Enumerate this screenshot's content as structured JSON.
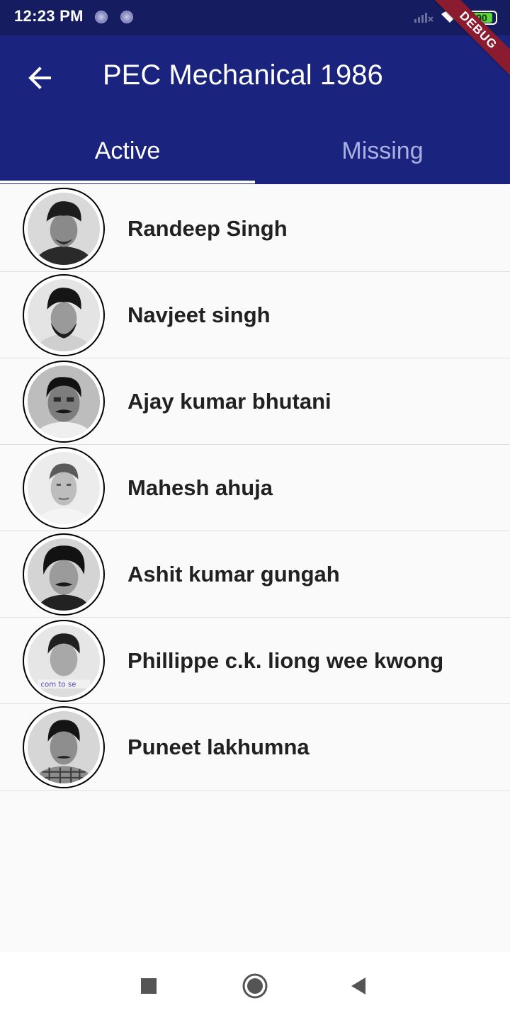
{
  "status_bar": {
    "time": "12:23 PM",
    "notification_icons": [
      "app-notification-icon",
      "app-notification-icon"
    ],
    "signal_icon": "signal-off-icon",
    "wifi_icon": "wifi-icon",
    "battery_level": "90",
    "battery_color": "#5fd33a"
  },
  "debug_banner": "DEBUG",
  "app_bar": {
    "back_icon": "arrow-left-icon",
    "title": "PEC Mechanical 1986",
    "background": "#1a237e"
  },
  "tabs": [
    {
      "label": "Active",
      "selected": true
    },
    {
      "label": "Missing",
      "selected": false
    }
  ],
  "members": [
    {
      "name": "Randeep Singh",
      "photo": "portrait-turban"
    },
    {
      "name": "Navjeet singh",
      "photo": "portrait-turban-beard"
    },
    {
      "name": "Ajay kumar bhutani",
      "photo": "portrait-mustache"
    },
    {
      "name": "Mahesh ahuja",
      "photo": "portrait-light"
    },
    {
      "name": "Ashit kumar gungah",
      "photo": "portrait-dark-hair"
    },
    {
      "name": "Phillippe c.k. liong wee kwong",
      "photo": "portrait-watermark"
    },
    {
      "name": "Puneet lakhumna",
      "photo": "portrait-checked-shirt"
    }
  ],
  "nav_bar": {
    "recents_icon": "square-icon",
    "home_icon": "circle-icon",
    "back_icon": "triangle-back-icon"
  }
}
